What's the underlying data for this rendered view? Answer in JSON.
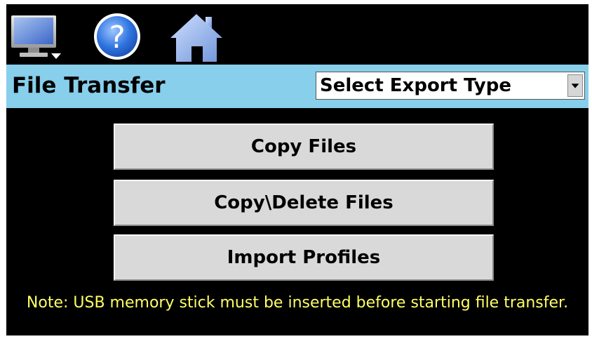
{
  "toolbar": {
    "icons": [
      "monitor-icon",
      "help-icon",
      "home-icon"
    ]
  },
  "header": {
    "title": "File Transfer",
    "export_select": {
      "value": "Select Export Type"
    }
  },
  "actions": {
    "copy_files": "Copy Files",
    "copy_delete_files": "Copy\\Delete Files",
    "import_profiles": "Import Profiles"
  },
  "note": "Note:  USB memory stick must be inserted before starting file transfer.",
  "colors": {
    "background": "#000000",
    "titlebar": "#87cfeb",
    "button": "#d9d9d9",
    "note_text": "#ffff66"
  }
}
